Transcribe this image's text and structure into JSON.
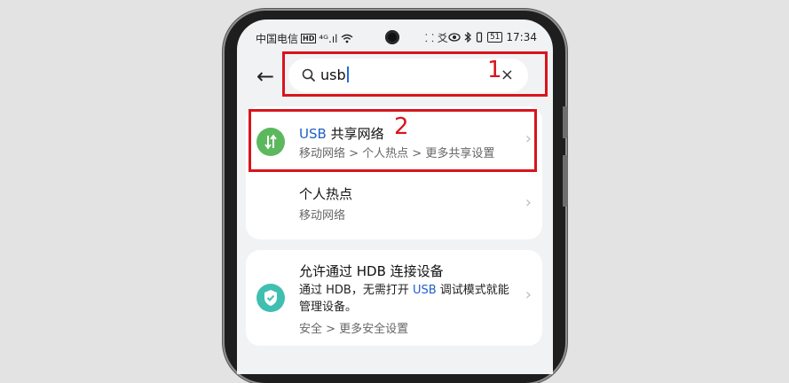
{
  "status_bar": {
    "carrier": "中国电信",
    "hd": "HD",
    "signal": "⁴ᴳ.ıl",
    "app_icons": "⸬ 爻",
    "battery": "51",
    "time": "17:34"
  },
  "search": {
    "query": "usb",
    "clear_symbol": "×",
    "back_symbol": "←"
  },
  "results": [
    {
      "title_prefix": "USB",
      "title_suffix": " 共享网络",
      "path": "移动网络 > 个人热点 > 更多共享设置"
    },
    {
      "title": "个人热点",
      "path": "移动网络"
    },
    {
      "title": "允许通过 HDB 连接设备",
      "desc_before": "通过 HDB，无需打开 ",
      "desc_highlight": "USB",
      "desc_after": " 调试模式就能管理设备。",
      "path": "安全 > 更多安全设置"
    }
  ],
  "annotations": [
    {
      "label": "1"
    },
    {
      "label": "2"
    }
  ],
  "colors": {
    "accent": "#d9141c",
    "highlight": "#1f5fc7",
    "usb_icon": "#5cb85c",
    "security_icon": "#3fbfb0"
  }
}
